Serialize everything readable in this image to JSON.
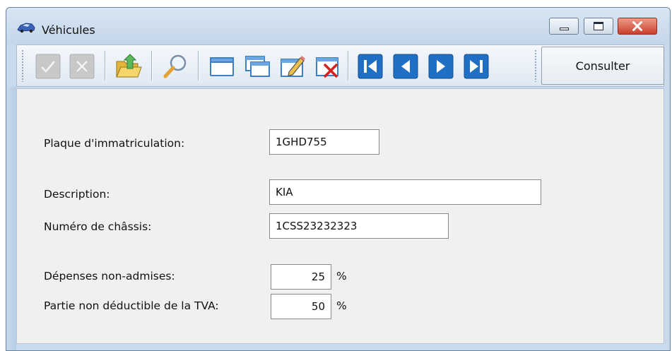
{
  "window": {
    "title": "Véhicules",
    "controls": [
      "minimize-icon",
      "maximize-icon",
      "close-icon"
    ]
  },
  "toolbar": {
    "buttons": [
      {
        "name": "validate",
        "icon": "check-icon",
        "enabled": false
      },
      {
        "name": "cancel",
        "icon": "x-icon",
        "enabled": false
      },
      {
        "name": "export",
        "icon": "folder-arrow-icon"
      },
      {
        "name": "search",
        "icon": "magnifier-icon"
      },
      {
        "name": "new",
        "icon": "window-icon"
      },
      {
        "name": "copy",
        "icon": "windows-icon"
      },
      {
        "name": "edit",
        "icon": "pencil-window-icon"
      },
      {
        "name": "delete",
        "icon": "delete-window-icon"
      },
      {
        "name": "first",
        "icon": "first-record-icon"
      },
      {
        "name": "previous",
        "icon": "previous-record-icon"
      },
      {
        "name": "next",
        "icon": "next-record-icon"
      },
      {
        "name": "last",
        "icon": "last-record-icon"
      }
    ],
    "consult_label": "Consulter",
    "accent_color": "#1f6fc4"
  },
  "form": {
    "plate": {
      "label": "Plaque d'immatriculation:",
      "value": "1GHD755"
    },
    "description": {
      "label": "Description:",
      "value": "KIA"
    },
    "chassis": {
      "label": "Numéro de châssis:",
      "value": "1CSS23232323"
    },
    "expenses": {
      "label": "Dépenses non-admises:",
      "value": "25",
      "unit": "%"
    },
    "vat": {
      "label": "Partie non déductible de la TVA:",
      "value": "50",
      "unit": "%"
    }
  }
}
